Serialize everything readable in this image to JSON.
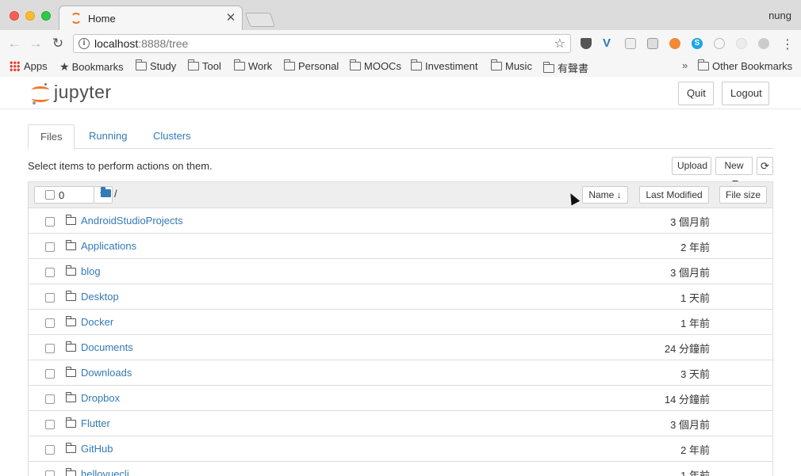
{
  "browser": {
    "tab_title": "Home",
    "tab_close": "✕",
    "profile": "nung",
    "url_host": "localhost",
    "url_rest": ":8888/tree",
    "nav_back": "←",
    "nav_forward": "→",
    "nav_reload": "↻",
    "star": "☆",
    "menu": "⋮"
  },
  "bookmarks": {
    "apps": "Apps",
    "items": [
      "Bookmarks",
      "Study",
      "Tool",
      "Work",
      "Personal",
      "MOOCs",
      "Investiment",
      "Music",
      "有聲書"
    ],
    "overflow": "»",
    "other": "Other Bookmarks"
  },
  "header": {
    "logo_text": "jupyter",
    "quit_label": "Quit",
    "logout_label": "Logout"
  },
  "tabs": {
    "files": "Files",
    "running": "Running",
    "clusters": "Clusters"
  },
  "toolbar": {
    "instructions": "Select items to perform actions on them.",
    "upload": "Upload",
    "new": "New",
    "refresh": "⟳"
  },
  "list_header": {
    "selected_count": "0",
    "breadcrumb_root": "/",
    "sort_name": "Name",
    "sort_name_arrow": "🡓",
    "sort_modified": "Last Modified",
    "sort_size": "File size"
  },
  "files": [
    {
      "name": "AndroidStudioProjects",
      "modified": "3 個月前"
    },
    {
      "name": "Applications",
      "modified": "2 年前"
    },
    {
      "name": "blog",
      "modified": "3 個月前"
    },
    {
      "name": "Desktop",
      "modified": "1 天前"
    },
    {
      "name": "Docker",
      "modified": "1 年前"
    },
    {
      "name": "Documents",
      "modified": "24 分鐘前"
    },
    {
      "name": "Downloads",
      "modified": "3 天前"
    },
    {
      "name": "Dropbox",
      "modified": "14 分鐘前"
    },
    {
      "name": "Flutter",
      "modified": "3 個月前"
    },
    {
      "name": "GitHub",
      "modified": "2 年前"
    },
    {
      "name": "hellovuecli",
      "modified": "1 年前"
    }
  ]
}
